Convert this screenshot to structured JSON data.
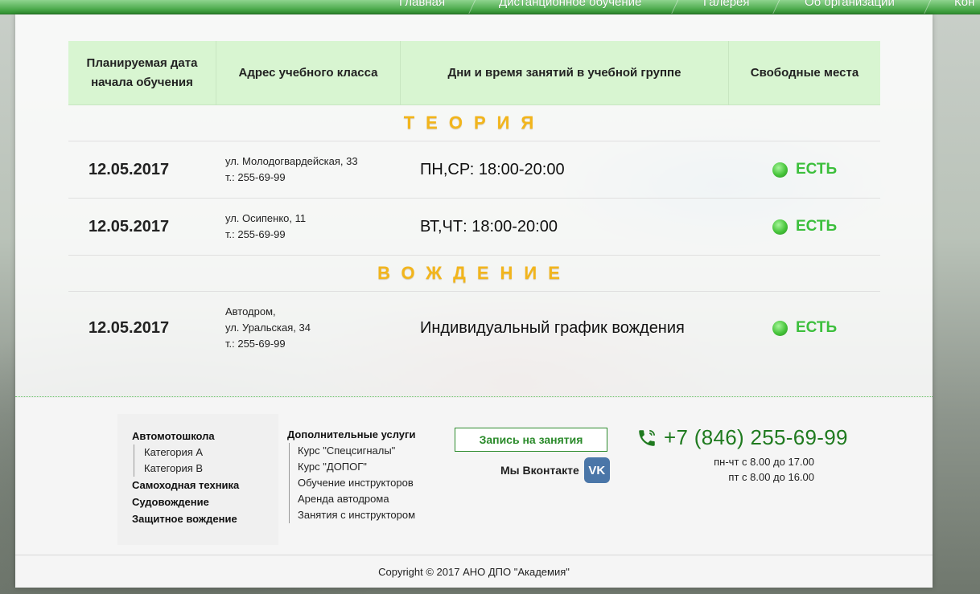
{
  "nav": {
    "items": [
      "Главная",
      "Дистанционное обучение",
      "Галерея",
      "Об организации",
      "Кон"
    ]
  },
  "table": {
    "headers": {
      "start_date": "Планируемая дата начала обучения",
      "address": "Адрес учебного класса",
      "schedule": "Дни и время занятий в учебной группе",
      "seats": "Свободные места"
    },
    "sections": [
      {
        "title": "ТЕОРИЯ",
        "rows": [
          {
            "date": "12.05.2017",
            "addr1": "ул. Молодогвардейская, 33",
            "addr2": "т.: 255-69-99",
            "schedule": "ПН,СР: 18:00-20:00",
            "seats": "ЕСТЬ"
          },
          {
            "date": "12.05.2017",
            "addr1": "ул. Осипенко, 11",
            "addr2": "т.: 255-69-99",
            "schedule": "ВТ,ЧТ: 18:00-20:00",
            "seats": "ЕСТЬ"
          }
        ]
      },
      {
        "title": "ВОЖДЕНИЕ",
        "rows": [
          {
            "date": "12.05.2017",
            "addr0": "Автодром,",
            "addr1": "ул. Уральская, 34",
            "addr2": "т.: 255-69-99",
            "schedule": "Индивидуальный график вождения",
            "seats": "ЕСТЬ"
          }
        ]
      }
    ]
  },
  "footer": {
    "col1": {
      "head": "Автомотошкола",
      "subs": [
        "Категория А",
        "Категория В"
      ],
      "links": [
        "Самоходная техника",
        "Судовождение",
        "Защитное вождение"
      ]
    },
    "col2": {
      "head": "Дополнительные услуги",
      "subs": [
        "Курс \"Спецсигналы\"",
        "Курс \"ДОПОГ\"",
        "Обучение инструкторов",
        "Аренда автодрома",
        "Занятия с инструктором"
      ]
    },
    "signup_label": "Запись на занятия",
    "vk_label": "Мы Вконтакте",
    "vk_icon_text": "VK",
    "phone": "+7 (846) 255-69-99",
    "hours1": "пн-чт с 8.00 до 17.00",
    "hours2": "пт с 8.00 до 16.00",
    "copyright": "Copyright © 2017 АНО ДПО \"Академия\""
  },
  "colors": {
    "accent_green": "#3cbf3c",
    "section_gold": "#f2b51c",
    "header_bg": "#d8f5d1",
    "vk_blue": "#4a76a8"
  }
}
